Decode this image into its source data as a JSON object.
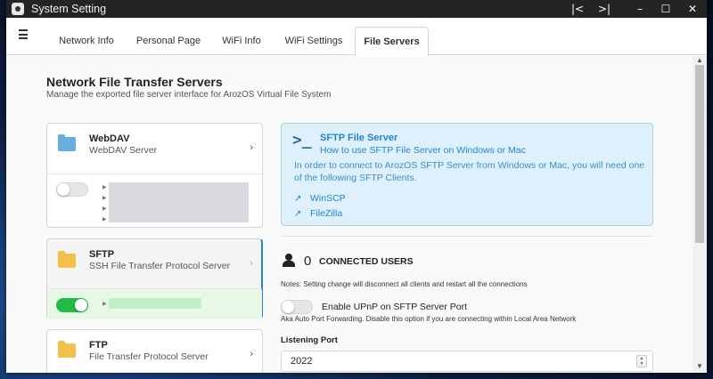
{
  "window": {
    "title": "System Setting",
    "controls": {
      "prev": "|<",
      "next": ">|",
      "minimize": "–",
      "maximize": "☐",
      "close": "✕"
    }
  },
  "tabs": [
    {
      "label": "Network Info",
      "active": false
    },
    {
      "label": "Personal Page",
      "active": false
    },
    {
      "label": "WiFi Info",
      "active": false
    },
    {
      "label": "WiFi Settings",
      "active": false
    },
    {
      "label": "File Servers",
      "active": true
    }
  ],
  "page": {
    "title": "Network File Transfer Servers",
    "subtitle": "Manage the exported file server interface for ArozOS Virtual File System"
  },
  "servers": [
    {
      "name": "WebDAV",
      "desc": "WebDAV Server",
      "icon": "folder-network-icon",
      "enabled": false
    },
    {
      "name": "SFTP",
      "desc": "SSH File Transfer Protocol Server",
      "icon": "folder-icon",
      "enabled": true
    },
    {
      "name": "FTP",
      "desc": "File Transfer Protocol Server",
      "icon": "folder-icon",
      "enabled": null
    }
  ],
  "info": {
    "icon_text": ">_",
    "title": "SFTP File Server",
    "subtitle": "How to use SFTP File Server on Windows or Mac",
    "body": "In order to connect to ArozOS SFTP Server from Windows or Mac, you will need one of the following SFTP Clients.",
    "links": [
      "WinSCP",
      "FileZilla"
    ]
  },
  "connected": {
    "count": "0",
    "label": "CONNECTED USERS",
    "note": "Notes: Setting change will disconnect all clients and restart all the connections"
  },
  "upnp": {
    "label": "Enable UPnP on SFTP Server Port",
    "help": "Aka Auto Port Forwarding. Disable this option if you are connecting within Local Area Network",
    "enabled": false
  },
  "port": {
    "label": "Listening Port",
    "value": "2022"
  },
  "colors": {
    "accent": "#2185d0",
    "toggle_on": "#21ba45",
    "info_bg": "#dff0fd"
  }
}
